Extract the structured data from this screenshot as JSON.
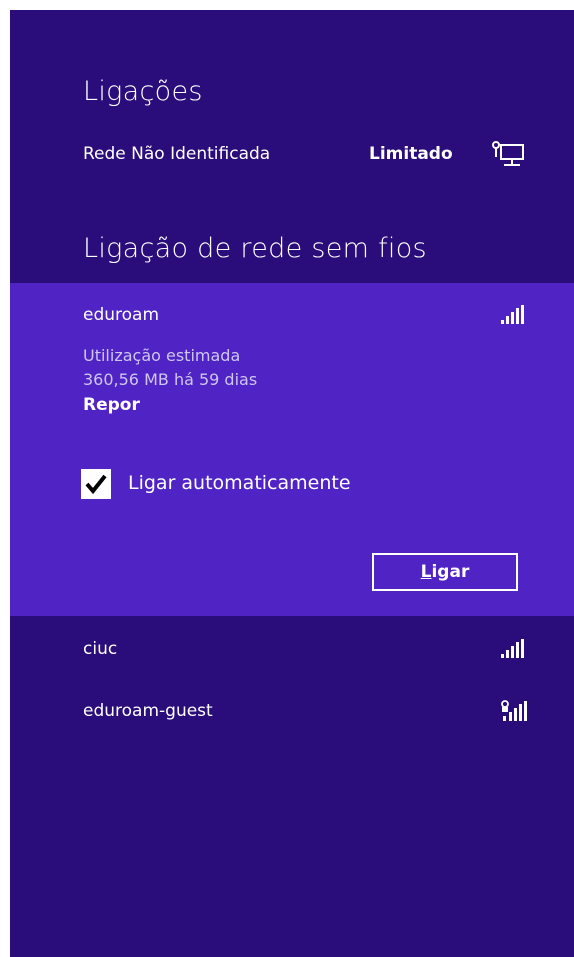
{
  "connections": {
    "title": "Ligações",
    "network_name": "Rede Não Identificada",
    "network_status": "Limitado",
    "network_icon": "wired-network-icon"
  },
  "wireless": {
    "title": "Ligação de rede sem fios",
    "selected": {
      "name": "eduroam",
      "signal_icon": "wifi-signal-icon",
      "usage_label": "Utilização estimada",
      "usage_value": "360,56 MB há 59 dias",
      "reset_label": "Repor",
      "auto_connect_label": "Ligar automaticamente",
      "auto_connect_checked": true,
      "connect_prefix": "L",
      "connect_rest": "igar"
    },
    "networks": [
      {
        "name": "ciuc",
        "signal_icon": "wifi-signal-icon"
      },
      {
        "name": "eduroam-guest",
        "signal_icon": "wifi-signal-secured-icon"
      }
    ]
  },
  "colors": {
    "panel_bg": "#2a0c7a",
    "selected_bg": "#4f23c4",
    "text": "#ffffff"
  }
}
